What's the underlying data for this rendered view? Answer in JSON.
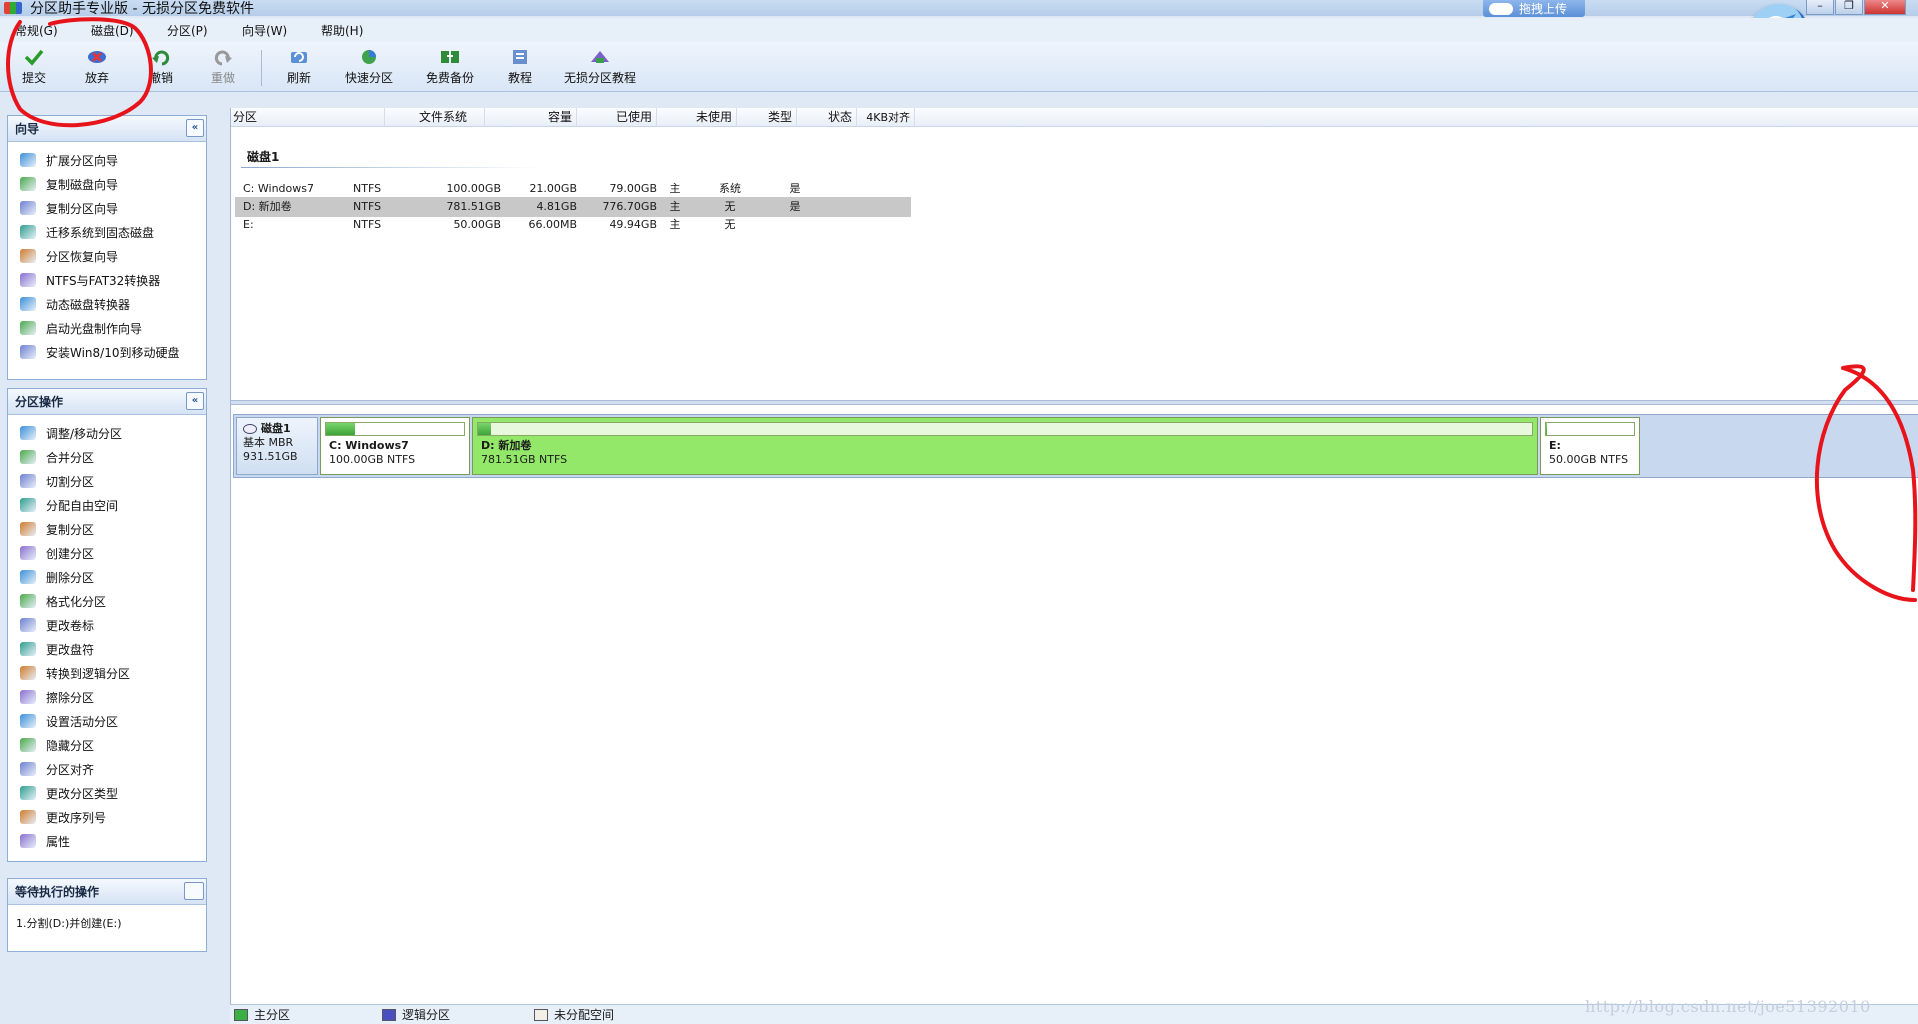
{
  "window": {
    "title": "分区助手专业版 - 无损分区免费软件",
    "baidu_upload": "拖拽上传",
    "controls": [
      "–",
      "❐",
      "✕"
    ]
  },
  "menu": [
    "常规(G)",
    "磁盘(D)",
    "分区(P)",
    "向导(W)",
    "帮助(H)"
  ],
  "toolbar": [
    {
      "label": "提交",
      "icon": "check-icon",
      "enabled": true
    },
    {
      "label": "放弃",
      "icon": "discard-icon",
      "enabled": true
    },
    {
      "label": "撤销",
      "icon": "undo-icon",
      "enabled": true
    },
    {
      "label": "重做",
      "icon": "redo-icon",
      "enabled": false
    },
    {
      "label": "刷新",
      "icon": "refresh-icon",
      "enabled": true
    },
    {
      "label": "快速分区",
      "icon": "quick-partition-icon",
      "enabled": true
    },
    {
      "label": "免费备份",
      "icon": "backup-icon",
      "enabled": true
    },
    {
      "label": "教程",
      "icon": "tutorial-icon",
      "enabled": true
    },
    {
      "label": "无损分区教程",
      "icon": "lossless-tutorial-icon",
      "enabled": true
    }
  ],
  "wizard_panel": {
    "title": "向导",
    "collapse": "«",
    "items": [
      "扩展分区向导",
      "复制磁盘向导",
      "复制分区向导",
      "迁移系统到固态磁盘",
      "分区恢复向导",
      "NTFS与FAT32转换器",
      "动态磁盘转换器",
      "启动光盘制作向导",
      "安装Win8/10到移动硬盘"
    ]
  },
  "ops_panel": {
    "title": "分区操作",
    "collapse": "«",
    "items": [
      "调整/移动分区",
      "合并分区",
      "切割分区",
      "分配自由空间",
      "复制分区",
      "创建分区",
      "删除分区",
      "格式化分区",
      "更改卷标",
      "更改盘符",
      "转换到逻辑分区",
      "擦除分区",
      "设置活动分区",
      "隐藏分区",
      "分区对齐",
      "更改分区类型",
      "更改序列号",
      "属性"
    ]
  },
  "pending_panel": {
    "title": "等待执行的操作",
    "items": [
      "1.分割(D:)并创建(E:)"
    ]
  },
  "table": {
    "columns": [
      "分区",
      "文件系统",
      "容量",
      "已使用",
      "未使用",
      "类型",
      "状态",
      "4KB对齐"
    ],
    "disk_label": "磁盘1",
    "rows": [
      {
        "name": "C: Windows7",
        "fs": "NTFS",
        "capacity": "100.00GB",
        "used": "21.00GB",
        "free": "79.00GB",
        "type": "主",
        "status": "系统",
        "aligned": "是",
        "selected": false
      },
      {
        "name": "D: 新加卷",
        "fs": "NTFS",
        "capacity": "781.51GB",
        "used": "4.81GB",
        "free": "776.70GB",
        "type": "主",
        "status": "无",
        "aligned": "是",
        "selected": true
      },
      {
        "name": "E:",
        "fs": "NTFS",
        "capacity": "50.00GB",
        "used": "66.00MB",
        "free": "49.94GB",
        "type": "主",
        "status": "无",
        "aligned": "",
        "selected": false
      }
    ]
  },
  "disk_map": {
    "disk_name": "磁盘1",
    "disk_type": "基本 MBR",
    "disk_size": "931.51GB",
    "partitions": [
      {
        "name": "C: Windows7",
        "size": "100.00GB NTFS",
        "used_fraction": 0.21,
        "selected": false
      },
      {
        "name": "D: 新加卷",
        "size": "781.51GB NTFS",
        "used_fraction": 0.006,
        "selected": true
      },
      {
        "name": "E:",
        "size": "50.00GB NTFS",
        "used_fraction": 0.001,
        "selected": false
      }
    ]
  },
  "status_legend": [
    {
      "label": "主分区",
      "color": "#3cb043"
    },
    {
      "label": "逻辑分区",
      "color": "#4a4fbf"
    },
    {
      "label": "未分配空间",
      "color": "#f3efe6"
    }
  ],
  "watermark": "http://blog.csdn.net/joe51392010",
  "colors": {
    "accent": "#2b6fc4",
    "partition_green": "#93e86a",
    "annotation_red": "#e8141b"
  }
}
